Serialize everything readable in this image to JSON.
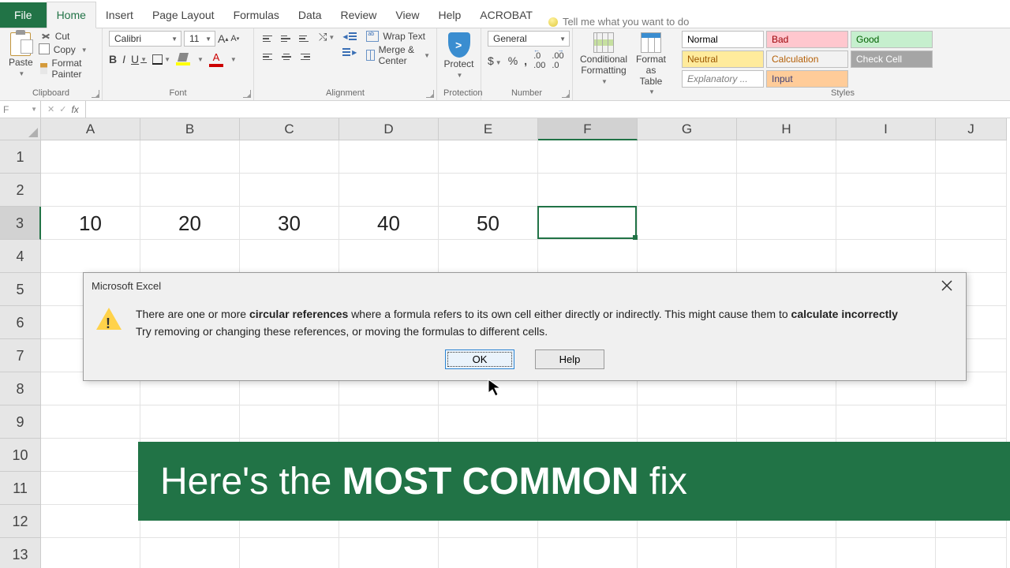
{
  "tabs": {
    "file": "File",
    "home": "Home",
    "insert": "Insert",
    "pagelayout": "Page Layout",
    "formulas": "Formulas",
    "data": "Data",
    "review": "Review",
    "view": "View",
    "help": "Help",
    "acrobat": "ACROBAT",
    "tellme": "Tell me what you want to do"
  },
  "clipboard": {
    "paste": "Paste",
    "cut": "Cut",
    "copy": "Copy",
    "painter": "Format Painter",
    "label": "Clipboard"
  },
  "font": {
    "name": "Calibri",
    "size": "11",
    "label": "Font"
  },
  "alignment": {
    "wrap": "Wrap Text",
    "merge": "Merge & Center",
    "label": "Alignment"
  },
  "protect": {
    "btn": "Protect",
    "label": "Protection"
  },
  "number": {
    "format": "General",
    "label": "Number"
  },
  "cond": {
    "cf": "Conditional Formatting",
    "tbl": "Format as Table"
  },
  "styles": {
    "cells": [
      {
        "t": "Normal",
        "c": "#000",
        "bg": "#ffffff"
      },
      {
        "t": "Bad",
        "c": "#9c0006",
        "bg": "#ffc7ce"
      },
      {
        "t": "Good",
        "c": "#006100",
        "bg": "#c6efce"
      },
      {
        "t": "Neutral",
        "c": "#9c5700",
        "bg": "#ffeb9c"
      },
      {
        "t": "Calculation",
        "c": "#b45f06",
        "bg": "#f2f2f2"
      },
      {
        "t": "Check Cell",
        "c": "#ffffff",
        "bg": "#a5a5a5"
      },
      {
        "t": "Explanatory ...",
        "c": "#7f7f7f",
        "bg": "#ffffff",
        "i": true
      },
      {
        "t": "Input",
        "c": "#3f3f76",
        "bg": "#ffcc99"
      }
    ],
    "label": "Styles"
  },
  "namebox": "F",
  "columns": [
    "A",
    "B",
    "C",
    "D",
    "E",
    "F",
    "G",
    "H",
    "I",
    "J"
  ],
  "rows": [
    "1",
    "2",
    "3",
    "4",
    "5",
    "6",
    "7",
    "8",
    "9",
    "10",
    "11",
    "12",
    "13"
  ],
  "data_row3": [
    "10",
    "20",
    "30",
    "40",
    "50",
    "",
    "",
    "",
    "",
    ""
  ],
  "selected": {
    "col": "F",
    "row": "3"
  },
  "dialog": {
    "title": "Microsoft Excel",
    "line1a": "There are one or more ",
    "bold1": "circular references",
    "line1b": " where a formula refers to its own cell either directly or indirectly. This might cause them to ",
    "bold2": "calculate incorrectly",
    "line2": "Try removing or changing these references, or moving the formulas to different cells.",
    "ok": "OK",
    "help": "Help"
  },
  "banner": {
    "pre": "Here's the ",
    "bold": "MOST COMMON",
    "post": " fix"
  }
}
